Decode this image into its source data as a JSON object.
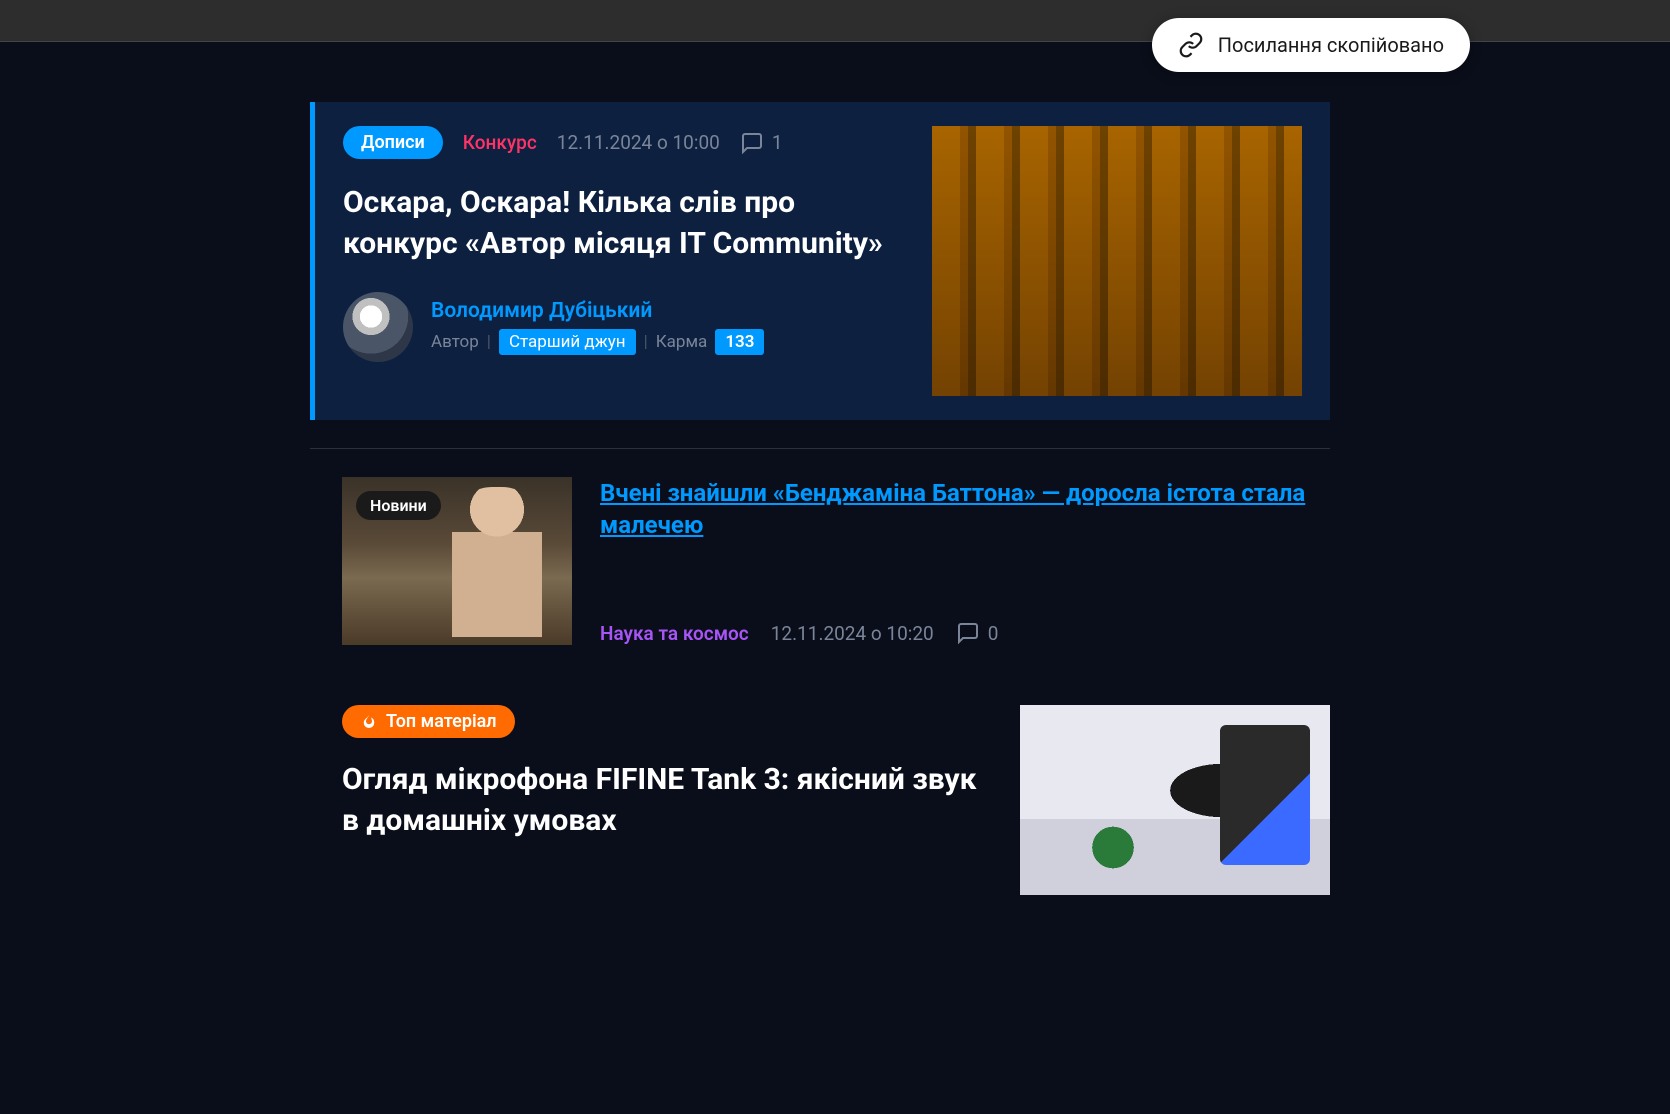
{
  "toast": {
    "text": "Посилання скопійовано"
  },
  "featured": {
    "badge": "Дописи",
    "category": "Конкурс",
    "date": "12.11.2024 о 10:00",
    "comments": "1",
    "title": "Оскара, Оскара! Кілька слів про конкурс «Автор місяця IT Community»",
    "author": {
      "name": "Володимир Дубіцький",
      "role": "Автор",
      "rank": "Старший джун",
      "karma_label": "Карма",
      "karma_value": "133"
    }
  },
  "article2": {
    "badge": "Новини",
    "title": "Вчені знайшли «Бенджаміна Баттона» — доросла істота стала малечею",
    "category": "Наука та космос",
    "date": "12.11.2024 о 10:20",
    "comments": "0"
  },
  "article3": {
    "badge": "Топ матеріал",
    "title": "Огляд мікрофона FIFINE Tank 3: якісний звук в домашніх умовах"
  }
}
